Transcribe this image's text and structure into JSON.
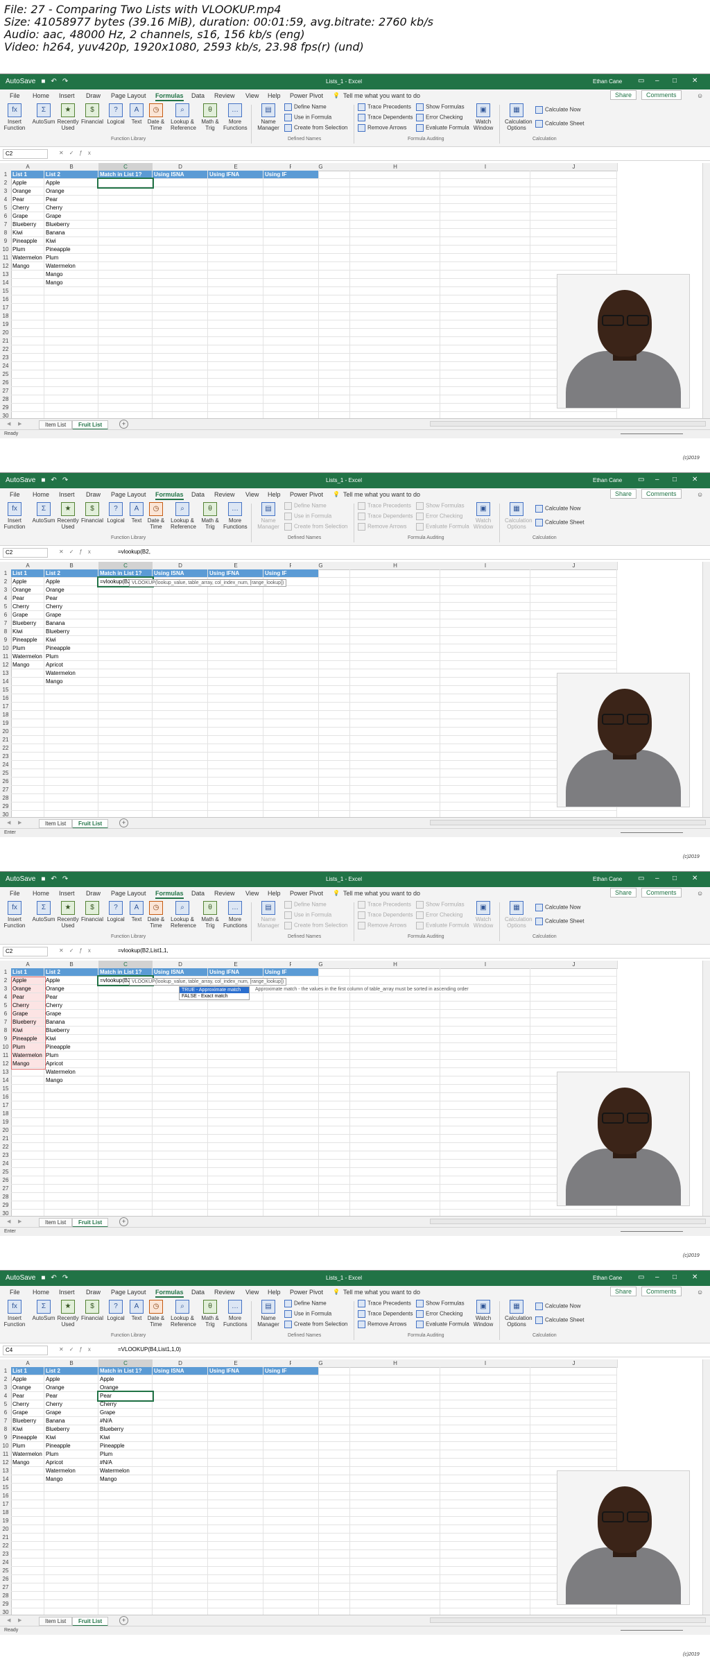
{
  "header": {
    "line1": "File: 27 - Comparing Two Lists with VLOOKUP.mp4",
    "line2": "Size: 41058977 bytes (39.16 MiB), duration: 00:01:59, avg.bitrate: 2760 kb/s",
    "line3": "Audio: aac, 48000 Hz, 2 channels, s16, 156 kb/s (eng)",
    "line4": "Video: h264, yuv420p, 1920x1080, 2593 kb/s, 23.98 fps(r) (und)"
  },
  "excel": {
    "doc_title": "Lists_1 - Excel",
    "user": "Ethan Cane",
    "autosave": "AutoSave",
    "tabs": [
      "File",
      "Home",
      "Insert",
      "Draw",
      "Page Layout",
      "Formulas",
      "Data",
      "Review",
      "View",
      "Help",
      "Power Pivot"
    ],
    "tell_me": "Tell me what you want to do",
    "share": "Share",
    "comments": "Comments",
    "ribbon": {
      "insert_function": "Insert Function",
      "autosum": "AutoSum",
      "recently_used": "Recently Used",
      "financial": "Financial",
      "logical": "Logical",
      "text": "Text",
      "date_time": "Date & Time",
      "lookup_reference": "Lookup & Reference",
      "math_trig": "Math & Trig",
      "more_functions": "More Functions",
      "function_library": "Function Library",
      "name_manager": "Name Manager",
      "define_name": "Define Name",
      "use_in_formula": "Use in Formula",
      "create_from_selection": "Create from Selection",
      "defined_names": "Defined Names",
      "trace_precedents": "Trace Precedents",
      "trace_dependents": "Trace Dependents",
      "remove_arrows": "Remove Arrows",
      "show_formulas": "Show Formulas",
      "error_checking": "Error Checking",
      "evaluate_formula": "Evaluate Formula",
      "watch_window": "Watch Window",
      "formula_auditing": "Formula Auditing",
      "calculation_options": "Calculation Options",
      "calculate_now": "Calculate Now",
      "calculate_sheet": "Calculate Sheet",
      "calculation": "Calculation"
    },
    "columns": [
      "A",
      "B",
      "C",
      "D",
      "E",
      "F",
      "G",
      "H",
      "I",
      "J"
    ],
    "headers": [
      "List 1",
      "List 2",
      "Match in List 1?",
      "Using ISNA",
      "Using IFNA",
      "Using IF"
    ],
    "list1": [
      "Apple",
      "Orange",
      "Pear",
      "Cherry",
      "Grape",
      "Blueberry",
      "Kiwi",
      "Pineapple",
      "Plum",
      "Watermelon",
      "Mango"
    ],
    "list2_first": [
      "Apple",
      "Orange",
      "Pear",
      "Cherry",
      "Grape",
      "Blueberry",
      "Banana",
      "Kiwi",
      "Pineapple",
      "Plum",
      "Watermelon",
      "Mango"
    ],
    "list2": [
      "Apple",
      "Orange",
      "Pear",
      "Cherry",
      "Grape",
      "Banana",
      "Blueberry",
      "Kiwi",
      "Pineapple",
      "Plum",
      "Apricot",
      "Watermelon",
      "Mango"
    ],
    "results": [
      "Apple",
      "Orange",
      "Pear",
      "Cherry",
      "Grape",
      "#N/A",
      "Blueberry",
      "Kiwi",
      "Pineapple",
      "Plum",
      "#N/A",
      "Watermelon",
      "Mango"
    ],
    "sheet_tabs": [
      "Item List",
      "Fruit List"
    ],
    "status_ready": "Ready",
    "status_enter": "Enter"
  },
  "frames": [
    {
      "namebox": "C2",
      "formula": ""
    },
    {
      "namebox": "C2",
      "formula": "=vlookup(B2,",
      "tooltip": "VLOOKUP(lookup_value, table_array, col_index_num, [range_lookup])"
    },
    {
      "namebox": "C2",
      "formula": "=vlookup(B2,List1,1,",
      "tooltip": "VLOOKUP(lookup_value, table_array, col_index_num, [range_lookup])",
      "dd_true": "TRUE - Approximate match",
      "dd_false": "FALSE - Exact match",
      "dd_note": "Approximate match - the values in the first column of table_array must be sorted in ascending order"
    },
    {
      "namebox": "C4",
      "formula": "=VLOOKUP(B4,List1,1,0)"
    }
  ],
  "watermark": "(c)2019"
}
